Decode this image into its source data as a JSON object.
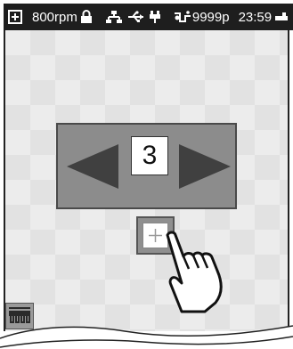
{
  "status_bar": {
    "speed": "800rpm",
    "count": "9999p",
    "time": "23:59"
  },
  "selector": {
    "value": "3"
  },
  "icons": {
    "status_left": "menu-square-icon",
    "lock": "lock-icon",
    "network": "network-icon",
    "usb": "usb-icon",
    "plug": "plug-icon",
    "counter": "thread-counter-icon",
    "battery": "battery-icon",
    "left_arrow": "left-arrow-icon",
    "right_arrow": "right-arrow-icon",
    "plus": "plus-icon",
    "hand": "pointing-hand-icon",
    "presser": "presser-foot-icon"
  },
  "colors": {
    "status_bg": "#1e1e1e",
    "panel_bg": "#8c8c8c",
    "arrow": "#4a4a4a"
  }
}
